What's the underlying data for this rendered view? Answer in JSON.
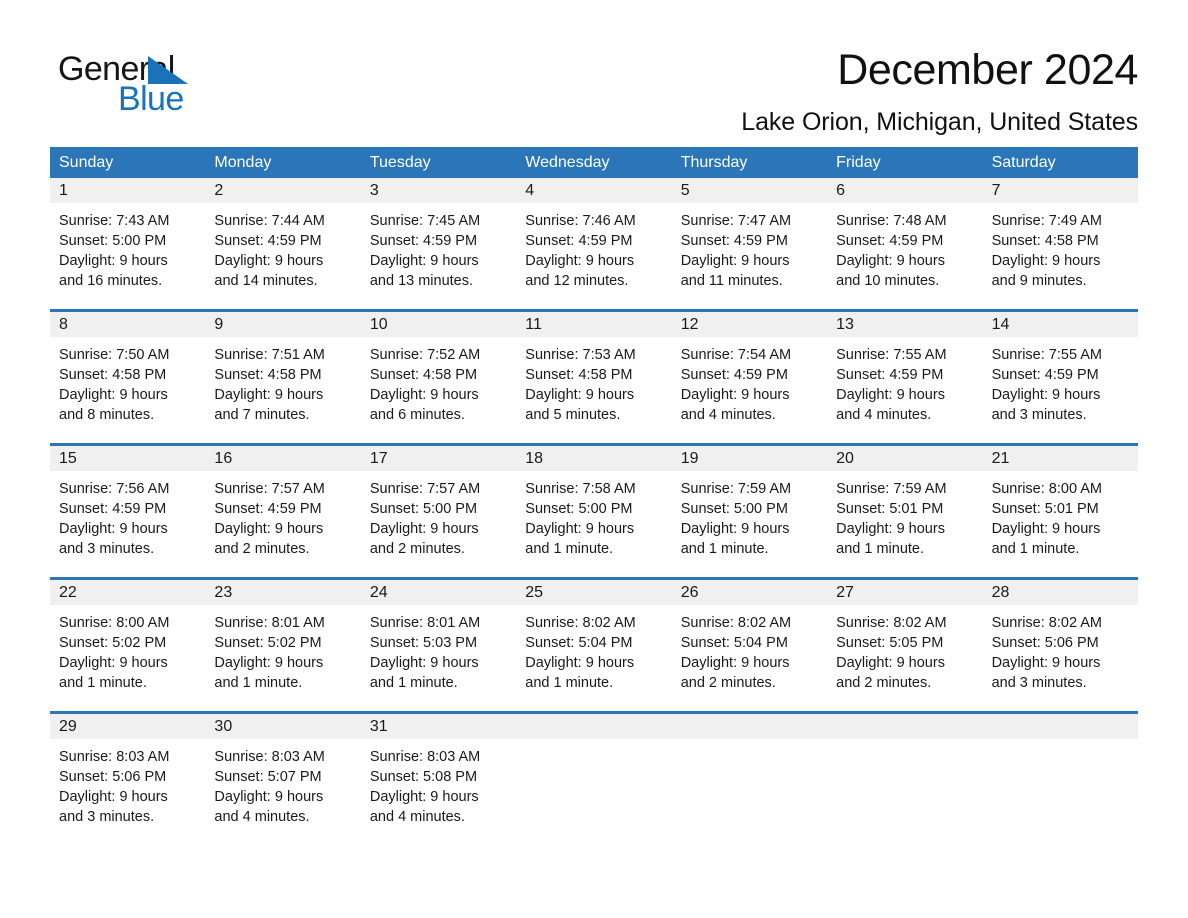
{
  "brand": {
    "name_top": "General",
    "name_bottom": "Blue",
    "accent_color": "#1a72b8"
  },
  "header": {
    "title": "December 2024",
    "location": "Lake Orion, Michigan, United States"
  },
  "calendar": {
    "header_bg": "#2b76b9",
    "day_band_bg": "#f0f0f0",
    "weekdays": [
      "Sunday",
      "Monday",
      "Tuesday",
      "Wednesday",
      "Thursday",
      "Friday",
      "Saturday"
    ],
    "weeks": [
      [
        {
          "day": "1",
          "lines": [
            "Sunrise: 7:43 AM",
            "Sunset: 5:00 PM",
            "Daylight: 9 hours",
            "and 16 minutes."
          ]
        },
        {
          "day": "2",
          "lines": [
            "Sunrise: 7:44 AM",
            "Sunset: 4:59 PM",
            "Daylight: 9 hours",
            "and 14 minutes."
          ]
        },
        {
          "day": "3",
          "lines": [
            "Sunrise: 7:45 AM",
            "Sunset: 4:59 PM",
            "Daylight: 9 hours",
            "and 13 minutes."
          ]
        },
        {
          "day": "4",
          "lines": [
            "Sunrise: 7:46 AM",
            "Sunset: 4:59 PM",
            "Daylight: 9 hours",
            "and 12 minutes."
          ]
        },
        {
          "day": "5",
          "lines": [
            "Sunrise: 7:47 AM",
            "Sunset: 4:59 PM",
            "Daylight: 9 hours",
            "and 11 minutes."
          ]
        },
        {
          "day": "6",
          "lines": [
            "Sunrise: 7:48 AM",
            "Sunset: 4:59 PM",
            "Daylight: 9 hours",
            "and 10 minutes."
          ]
        },
        {
          "day": "7",
          "lines": [
            "Sunrise: 7:49 AM",
            "Sunset: 4:58 PM",
            "Daylight: 9 hours",
            "and 9 minutes."
          ]
        }
      ],
      [
        {
          "day": "8",
          "lines": [
            "Sunrise: 7:50 AM",
            "Sunset: 4:58 PM",
            "Daylight: 9 hours",
            "and 8 minutes."
          ]
        },
        {
          "day": "9",
          "lines": [
            "Sunrise: 7:51 AM",
            "Sunset: 4:58 PM",
            "Daylight: 9 hours",
            "and 7 minutes."
          ]
        },
        {
          "day": "10",
          "lines": [
            "Sunrise: 7:52 AM",
            "Sunset: 4:58 PM",
            "Daylight: 9 hours",
            "and 6 minutes."
          ]
        },
        {
          "day": "11",
          "lines": [
            "Sunrise: 7:53 AM",
            "Sunset: 4:58 PM",
            "Daylight: 9 hours",
            "and 5 minutes."
          ]
        },
        {
          "day": "12",
          "lines": [
            "Sunrise: 7:54 AM",
            "Sunset: 4:59 PM",
            "Daylight: 9 hours",
            "and 4 minutes."
          ]
        },
        {
          "day": "13",
          "lines": [
            "Sunrise: 7:55 AM",
            "Sunset: 4:59 PM",
            "Daylight: 9 hours",
            "and 4 minutes."
          ]
        },
        {
          "day": "14",
          "lines": [
            "Sunrise: 7:55 AM",
            "Sunset: 4:59 PM",
            "Daylight: 9 hours",
            "and 3 minutes."
          ]
        }
      ],
      [
        {
          "day": "15",
          "lines": [
            "Sunrise: 7:56 AM",
            "Sunset: 4:59 PM",
            "Daylight: 9 hours",
            "and 3 minutes."
          ]
        },
        {
          "day": "16",
          "lines": [
            "Sunrise: 7:57 AM",
            "Sunset: 4:59 PM",
            "Daylight: 9 hours",
            "and 2 minutes."
          ]
        },
        {
          "day": "17",
          "lines": [
            "Sunrise: 7:57 AM",
            "Sunset: 5:00 PM",
            "Daylight: 9 hours",
            "and 2 minutes."
          ]
        },
        {
          "day": "18",
          "lines": [
            "Sunrise: 7:58 AM",
            "Sunset: 5:00 PM",
            "Daylight: 9 hours",
            "and 1 minute."
          ]
        },
        {
          "day": "19",
          "lines": [
            "Sunrise: 7:59 AM",
            "Sunset: 5:00 PM",
            "Daylight: 9 hours",
            "and 1 minute."
          ]
        },
        {
          "day": "20",
          "lines": [
            "Sunrise: 7:59 AM",
            "Sunset: 5:01 PM",
            "Daylight: 9 hours",
            "and 1 minute."
          ]
        },
        {
          "day": "21",
          "lines": [
            "Sunrise: 8:00 AM",
            "Sunset: 5:01 PM",
            "Daylight: 9 hours",
            "and 1 minute."
          ]
        }
      ],
      [
        {
          "day": "22",
          "lines": [
            "Sunrise: 8:00 AM",
            "Sunset: 5:02 PM",
            "Daylight: 9 hours",
            "and 1 minute."
          ]
        },
        {
          "day": "23",
          "lines": [
            "Sunrise: 8:01 AM",
            "Sunset: 5:02 PM",
            "Daylight: 9 hours",
            "and 1 minute."
          ]
        },
        {
          "day": "24",
          "lines": [
            "Sunrise: 8:01 AM",
            "Sunset: 5:03 PM",
            "Daylight: 9 hours",
            "and 1 minute."
          ]
        },
        {
          "day": "25",
          "lines": [
            "Sunrise: 8:02 AM",
            "Sunset: 5:04 PM",
            "Daylight: 9 hours",
            "and 1 minute."
          ]
        },
        {
          "day": "26",
          "lines": [
            "Sunrise: 8:02 AM",
            "Sunset: 5:04 PM",
            "Daylight: 9 hours",
            "and 2 minutes."
          ]
        },
        {
          "day": "27",
          "lines": [
            "Sunrise: 8:02 AM",
            "Sunset: 5:05 PM",
            "Daylight: 9 hours",
            "and 2 minutes."
          ]
        },
        {
          "day": "28",
          "lines": [
            "Sunrise: 8:02 AM",
            "Sunset: 5:06 PM",
            "Daylight: 9 hours",
            "and 3 minutes."
          ]
        }
      ],
      [
        {
          "day": "29",
          "lines": [
            "Sunrise: 8:03 AM",
            "Sunset: 5:06 PM",
            "Daylight: 9 hours",
            "and 3 minutes."
          ]
        },
        {
          "day": "30",
          "lines": [
            "Sunrise: 8:03 AM",
            "Sunset: 5:07 PM",
            "Daylight: 9 hours",
            "and 4 minutes."
          ]
        },
        {
          "day": "31",
          "lines": [
            "Sunrise: 8:03 AM",
            "Sunset: 5:08 PM",
            "Daylight: 9 hours",
            "and 4 minutes."
          ]
        },
        {
          "day": "",
          "lines": []
        },
        {
          "day": "",
          "lines": []
        },
        {
          "day": "",
          "lines": []
        },
        {
          "day": "",
          "lines": []
        }
      ]
    ]
  }
}
